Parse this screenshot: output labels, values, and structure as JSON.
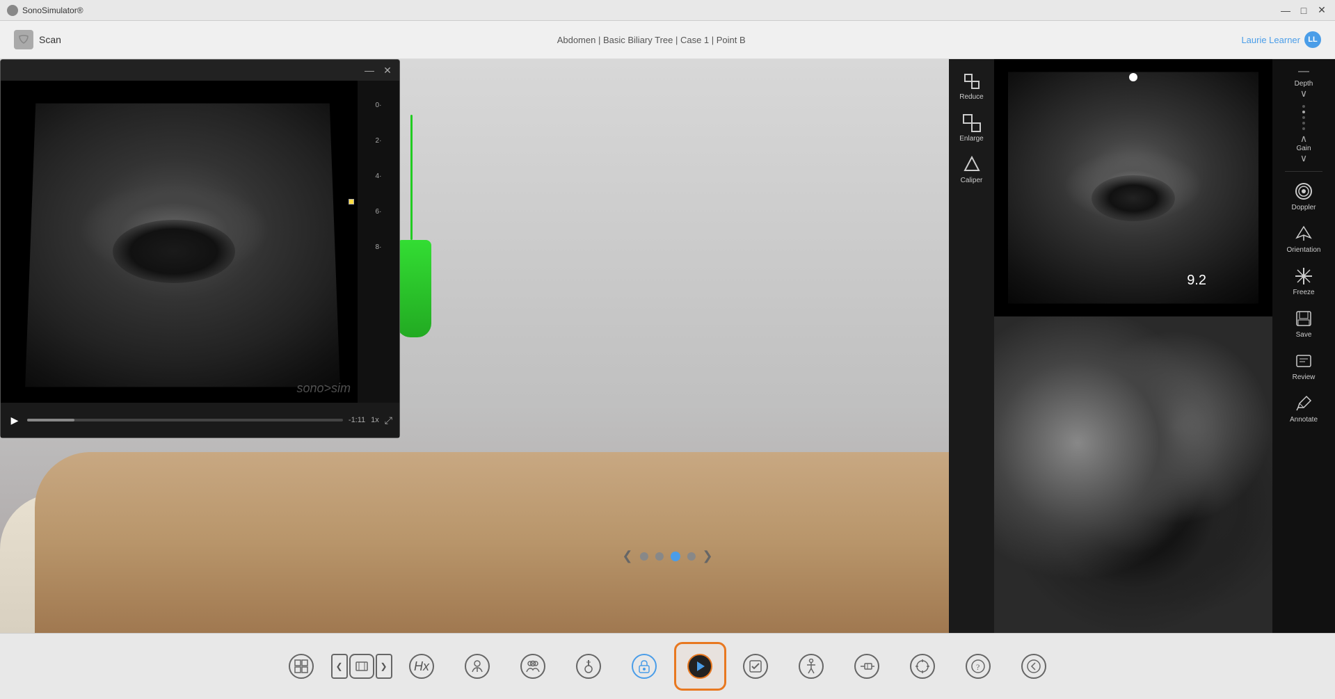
{
  "titlebar": {
    "title": "SonoSimulator®",
    "minimize_label": "—",
    "maximize_label": "□",
    "close_label": "✕"
  },
  "topbar": {
    "scan_label": "Scan",
    "breadcrumb": "Abdomen  |  Basic Biliary Tree  |  Case 1  |  Point B",
    "user_label": "Laurie Learner",
    "user_initials": "LL"
  },
  "us_popup": {
    "minimize_label": "—",
    "close_label": "✕",
    "time_label": "-1:11",
    "speed_label": "1x"
  },
  "side_toolbar": {
    "items": [
      {
        "id": "reduce",
        "label": "Reduce",
        "icon": "⊟"
      },
      {
        "id": "enlarge",
        "label": "Enlarge",
        "icon": "⊞"
      },
      {
        "id": "caliper",
        "label": "Caliper",
        "icon": "△"
      }
    ]
  },
  "right_controls": {
    "depth_gain_label": "Depth Gain",
    "depth_label": "Depth",
    "gain_label": "Gain",
    "doppler_label": "Doppler",
    "orientation_label": "Orientation",
    "freeze_label": "Freeze",
    "save_label": "Save",
    "review_label": "Review",
    "annotate_label": "Annotate",
    "depth_value": "9.2"
  },
  "nav": {
    "prev_label": "❮",
    "next_label": "❯",
    "dots": [
      {
        "active": false
      },
      {
        "active": false
      },
      {
        "active": true
      },
      {
        "active": false
      }
    ]
  },
  "bottom_toolbar": {
    "items": [
      {
        "id": "grid",
        "label": "",
        "icon": "⊞"
      },
      {
        "id": "image-nav",
        "label": "",
        "icon": "◫"
      },
      {
        "id": "history",
        "label": "Hx",
        "icon": ""
      },
      {
        "id": "patient",
        "label": "",
        "icon": "👤"
      },
      {
        "id": "group",
        "label": "",
        "icon": "👥"
      },
      {
        "id": "probe",
        "label": "",
        "icon": "⌁"
      },
      {
        "id": "lock",
        "label": "",
        "icon": "🔒"
      },
      {
        "id": "play",
        "label": "",
        "icon": "▶",
        "active": true
      },
      {
        "id": "checklist",
        "label": "",
        "icon": "✓"
      },
      {
        "id": "mannequin",
        "label": "",
        "icon": "◯"
      },
      {
        "id": "injection",
        "label": "",
        "icon": "💉"
      },
      {
        "id": "crosshair",
        "label": "",
        "icon": "⊕"
      },
      {
        "id": "help",
        "label": "",
        "icon": "?"
      },
      {
        "id": "back",
        "label": "",
        "icon": "←"
      }
    ]
  }
}
